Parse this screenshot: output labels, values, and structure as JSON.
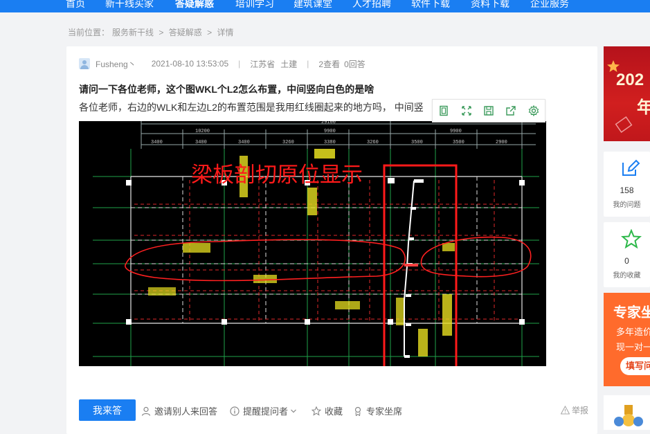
{
  "nav": {
    "items": [
      "首页",
      "新干线买家",
      "答疑解惑",
      "培训学习",
      "建筑课堂",
      "人才招聘",
      "软件下载",
      "资料下载",
      "企业服务"
    ],
    "active_index": 2
  },
  "breadcrumb": {
    "prefix": "当前位置：",
    "items": [
      "服务新干线",
      "答疑解惑",
      "详情"
    ],
    "separator": ">"
  },
  "question": {
    "author": "Fusheng丶",
    "datetime": "2021-08-10 13:53:05",
    "region": "江苏省",
    "category": "土建",
    "views": "2查看",
    "answers": "0回答",
    "title": "请问一下各位老师，这个图WKL个L2怎么布置，中间竖向白色的是啥",
    "description": "各位老师，右边的WLK和左边L2的布置范围是我用红线圈起来的地方吗， 中间竖"
  },
  "image_toolbar": {
    "icons": [
      "fit-screen-icon",
      "fullscreen-icon",
      "save-icon",
      "share-icon",
      "settings-icon"
    ]
  },
  "drawing": {
    "annotation": "梁板剖切原位显示",
    "top_dims": [
      "29100",
      "10200",
      "9900",
      "9900"
    ],
    "sub_dims": [
      "3400",
      "3400",
      "3400",
      "3260",
      "3380",
      "3260",
      "3500",
      "3500",
      "2900"
    ]
  },
  "actions": {
    "answer": "我来答",
    "invite": "邀请别人来回答",
    "remind": "提醒提问者",
    "favorite": "收藏",
    "expert": "专家坐席",
    "report": "举报"
  },
  "sidebar": {
    "banner_text": "202",
    "banner_text2": "年",
    "questions_count": "158",
    "questions_label": "我的问题",
    "favorites_count": "0",
    "favorites_label": "我的收藏",
    "promo_title": "专家坐",
    "promo_line1": "多年造价",
    "promo_line2": "现一对一",
    "promo_button": "填写问"
  },
  "colors": {
    "brand_blue": "#1a7ef2",
    "annotation_red": "#ff1a1a",
    "promo_orange": "#ff6b2c"
  }
}
